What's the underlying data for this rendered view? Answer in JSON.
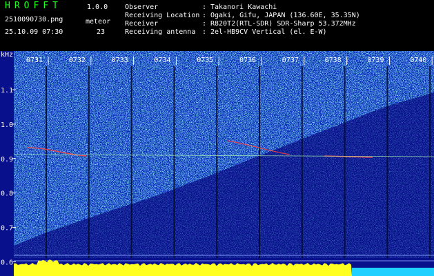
{
  "header": {
    "app_title": "HROFFT",
    "version": "1.0.0",
    "file_name": "2510090730.png",
    "date_time": "25.10.09 07:30",
    "meteor_label": "meteor",
    "meteor_count": "23"
  },
  "station_info": [
    {
      "label": "Observer",
      "value": "Takanori Kawachi"
    },
    {
      "label": "Receiving Location",
      "value": "Ogaki, Gifu, JAPAN (136.60E, 35.35N)"
    },
    {
      "label": "Receiver",
      "value": "R820T2(RTL-SDR) SDR-Sharp 53.372MHz"
    },
    {
      "label": "Receiving antenna",
      "value": "2el-HB9CV Vertical (el. E-W)"
    }
  ],
  "spectrogram": {
    "unit_label": "kHz",
    "time_labels": [
      "0731",
      "0732",
      "0733",
      "0734",
      "0735",
      "0736",
      "0737",
      "0738",
      "0739",
      "0740"
    ],
    "freq_labels": [
      "1.1",
      "1.0",
      "0.9",
      "0.8",
      "0.7",
      "0.6"
    ],
    "freq_range_khz": [
      0.6,
      1.15
    ],
    "colors": {
      "background": "#08108c",
      "noise_dense": "#2aa0e8",
      "meteor_trace": "#ff4040",
      "level_bar": "#ffff20",
      "grid": "#ffffff",
      "label": "#ffffff"
    }
  }
}
